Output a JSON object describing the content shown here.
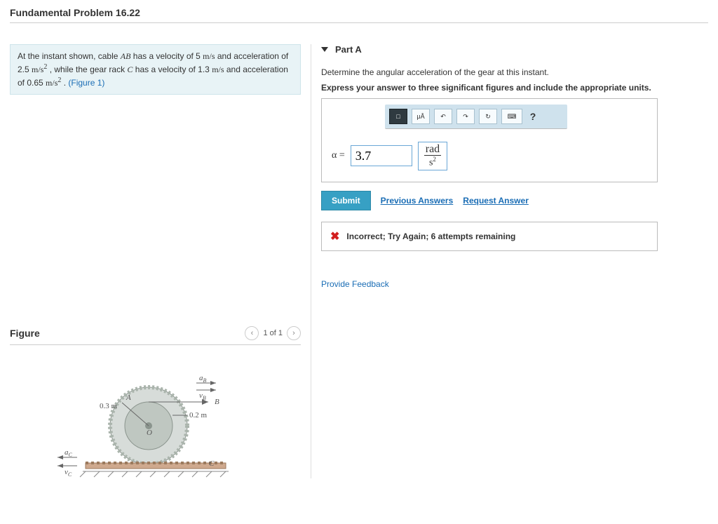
{
  "title": "Fundamental Problem 16.22",
  "stem": {
    "t1": "At the instant shown, cable ",
    "ab": "AB",
    "t2": " has a velocity of 5 ",
    "u_ms": "m/s",
    "t3": " and acceleration of 2.5 ",
    "u_ms2": "m/s",
    "t4": " , while the gear rack ",
    "c": "C",
    "t5": " has a velocity of 1.3 ",
    "t6": " and acceleration of 0.65 ",
    "t7": " . ",
    "figref": "(Figure 1)"
  },
  "figure": {
    "heading": "Figure",
    "pager": "1 of 1",
    "labels": {
      "aB": "a",
      "aB_sub": "B",
      "vB": "v",
      "vB_sub": "B",
      "B": "B",
      "A": "A",
      "O": "O",
      "C": "C",
      "aC": "a",
      "aC_sub": "C",
      "vC": "v",
      "vC_sub": "C",
      "r_outer": "0.3 m",
      "r_inner": "0.2 m"
    }
  },
  "part": {
    "label": "Part A",
    "prompt1": "Determine the angular acceleration of the gear at this instant.",
    "prompt2": "Express your answer to three significant figures and include the appropriate units."
  },
  "toolbar": {
    "templates": "□",
    "mu": "μÅ",
    "undo": "↶",
    "redo": "↷",
    "reset": "↻",
    "kb": "⌨",
    "help": "?"
  },
  "answer": {
    "varlabel": "α =",
    "value": "3.7",
    "unit_num": "rad",
    "unit_den_base": "s",
    "unit_den_exp": "2"
  },
  "actions": {
    "submit": "Submit",
    "prev": "Previous Answers",
    "req": "Request Answer"
  },
  "feedback": {
    "text": "Incorrect; Try Again; 6 attempts remaining"
  },
  "provide": "Provide Feedback"
}
